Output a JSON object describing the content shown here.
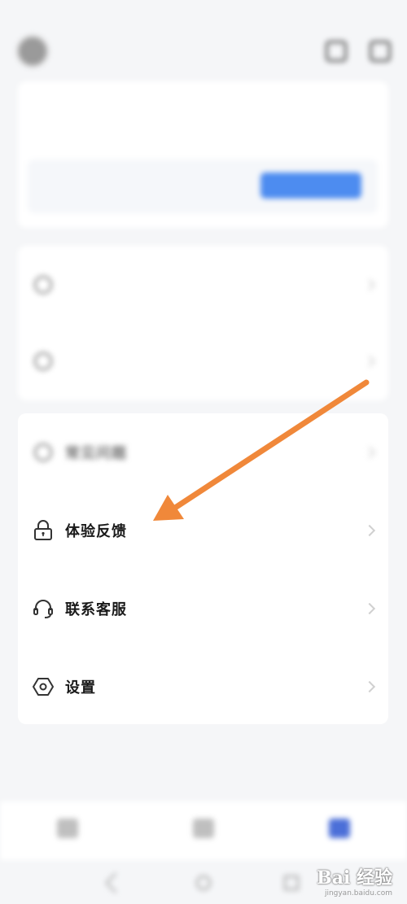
{
  "status_bar": {
    "left": "",
    "right": ""
  },
  "header": {
    "user_name": ""
  },
  "vip_card": {
    "title": "",
    "link": "",
    "inner_text": "",
    "button": ""
  },
  "menu_top": [
    {
      "label": ""
    },
    {
      "label": ""
    }
  ],
  "menu_main": [
    {
      "label": "常见问题",
      "icon": "question-icon"
    },
    {
      "label": "体验反馈",
      "icon": "lock-icon"
    },
    {
      "label": "联系客服",
      "icon": "headset-icon"
    },
    {
      "label": "设置",
      "icon": "settings-hex-icon"
    }
  ],
  "bottom_nav": [
    {
      "label": "",
      "icon": "home-icon"
    },
    {
      "label": "",
      "icon": "discover-icon"
    },
    {
      "label": "",
      "icon": "profile-icon",
      "active": true
    }
  ],
  "watermark": {
    "logo": "Bai 经验",
    "url": "jingyan.baidu.com"
  },
  "colors": {
    "accent": "#4d8cf0",
    "arrow": "#f0883a",
    "background": "#f5f6f8"
  }
}
